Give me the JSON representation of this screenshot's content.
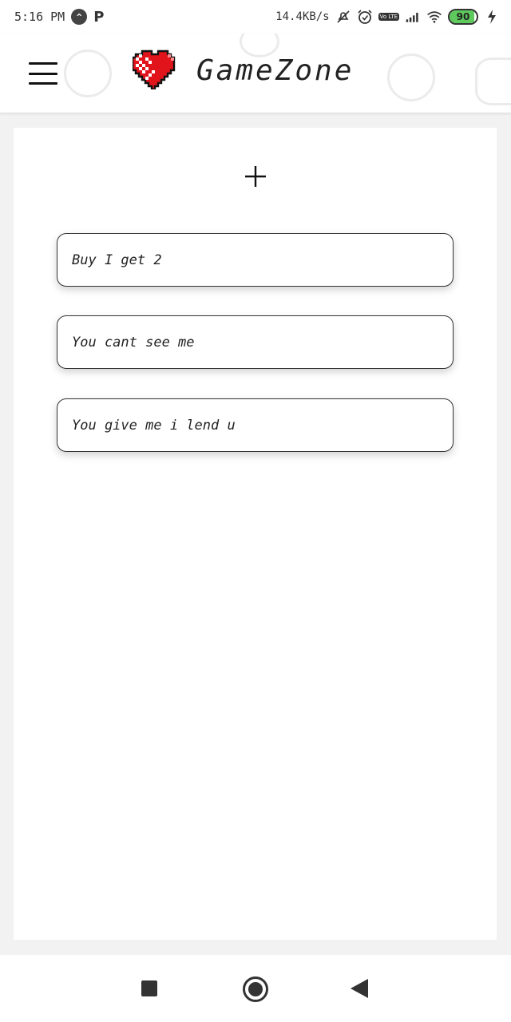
{
  "status_bar": {
    "time": "5:16 PM",
    "notification_icons": [
      "arrow-up-circle-icon",
      "p-icon"
    ],
    "notification_p": "P",
    "network_speed": "14.4KB/s",
    "volte_label": "Vo LTE",
    "battery_level": "90",
    "battery_fraction": 0.9,
    "icons": [
      "mute-icon",
      "alarm-icon",
      "volte-icon",
      "signal-icon",
      "wifi-icon",
      "battery-icon",
      "charging-icon"
    ]
  },
  "header": {
    "title": "GameZone",
    "menu_icon": "hamburger-menu-icon",
    "logo_icon": "pixel-heart-icon"
  },
  "main": {
    "add_icon": "plus-icon",
    "todos": [
      {
        "text": "Buy I get 2"
      },
      {
        "text": "You cant see me"
      },
      {
        "text": "You give me i lend u"
      }
    ]
  },
  "nav_bar": {
    "icons": [
      "recents-square-icon",
      "home-circle-icon",
      "back-triangle-icon"
    ]
  },
  "colors": {
    "background": "#f2f2f2",
    "card": "#ffffff",
    "heart_red": "#e2141b",
    "battery_green": "#5ec95c",
    "text": "#222222"
  }
}
